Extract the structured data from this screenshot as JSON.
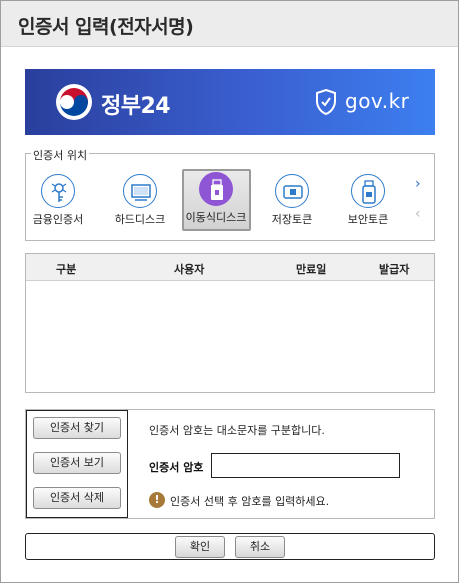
{
  "window": {
    "title": "인증서 입력(전자서명)"
  },
  "banner": {
    "name": "정부24",
    "domain": "gov.kr"
  },
  "location": {
    "legend": "인증서 위치",
    "items": [
      {
        "label": "금융인증서",
        "icon": "financial-cert-icon"
      },
      {
        "label": "하드디스크",
        "icon": "hard-disk-icon"
      },
      {
        "label": "이동식디스크",
        "icon": "usb-drive-icon",
        "selected": true
      },
      {
        "label": "저장토큰",
        "icon": "storage-token-icon"
      },
      {
        "label": "보안토큰",
        "icon": "security-token-icon"
      }
    ],
    "next": "›",
    "prev": "‹"
  },
  "table": {
    "columns": [
      "구분",
      "사용자",
      "만료일",
      "발급자"
    ],
    "rows": []
  },
  "actions": {
    "find": "인증서 찾기",
    "view": "인증서 보기",
    "delete": "인증서 삭제"
  },
  "password": {
    "info": "인증서 암호는 대소문자를 구분합니다.",
    "label": "인증서 암호",
    "value": "",
    "warning_icon": "!",
    "warning": "인증서 선택 후 암호를 입력하세요."
  },
  "footer": {
    "ok": "확인",
    "cancel": "취소"
  },
  "colors": {
    "banner_start": "#2a3f9c",
    "banner_end": "#3c7ff0",
    "accent": "#2f7bcb",
    "selected_icon": "#8e55d4"
  }
}
